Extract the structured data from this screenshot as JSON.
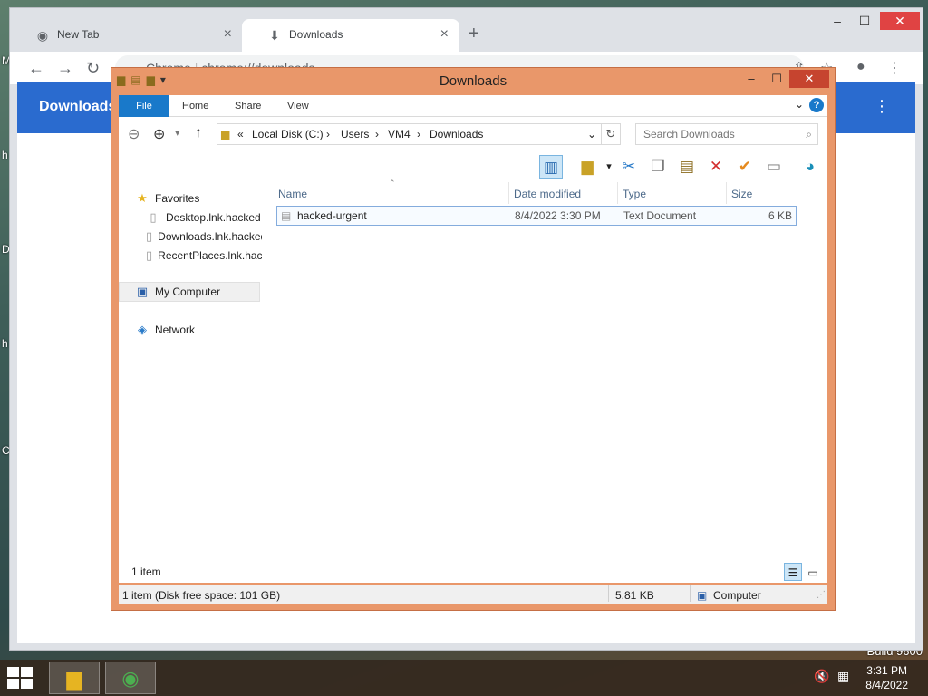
{
  "desktop": {
    "edge_letters": [
      "M",
      "h",
      "D",
      "h",
      "C"
    ],
    "build": "Build 9600"
  },
  "chrome": {
    "tabs": [
      {
        "label": "New Tab",
        "icon": "chrome-icon"
      },
      {
        "label": "Downloads",
        "icon": "download-icon"
      }
    ],
    "omnibox_prefix": "Chrome",
    "omnibox_url": "chrome://downloads",
    "page_title": "Downloads"
  },
  "explorer": {
    "title": "Downloads",
    "ribbon_tabs": [
      "File",
      "Home",
      "Share",
      "View"
    ],
    "address": {
      "prefix": "«",
      "segments": [
        "Local Disk (C:)",
        "Users",
        "VM4",
        "Downloads"
      ]
    },
    "search_placeholder": "Search Downloads",
    "nav": {
      "favorites_label": "Favorites",
      "favorites": [
        "Desktop.lnk.hacked",
        "Downloads.lnk.hacked",
        "RecentPlaces.lnk.hacked"
      ],
      "my_computer": "My Computer",
      "network": "Network"
    },
    "columns": [
      "Name",
      "Date modified",
      "Type",
      "Size"
    ],
    "files": [
      {
        "name": "hacked-urgent",
        "date": "8/4/2022 3:30 PM",
        "type": "Text Document",
        "size": "6 KB"
      }
    ],
    "item_count": "1 item",
    "status": {
      "summary": "1 item (Disk free space: 101 GB)",
      "size": "5.81 KB",
      "location": "Computer"
    }
  },
  "taskbar": {
    "time": "3:31 PM",
    "date": "8/4/2022"
  }
}
